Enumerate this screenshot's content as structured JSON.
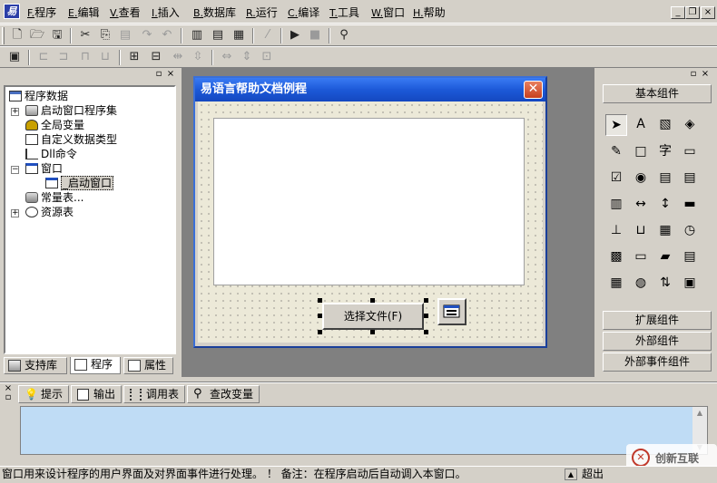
{
  "menu": {
    "items": [
      {
        "key": "F.",
        "label": "程序"
      },
      {
        "key": "E.",
        "label": "编辑"
      },
      {
        "key": "V.",
        "label": "查看"
      },
      {
        "key": "I.",
        "label": "插入"
      },
      {
        "key": "B.",
        "label": "数据库"
      },
      {
        "key": "R.",
        "label": "运行"
      },
      {
        "key": "C.",
        "label": "编译"
      },
      {
        "key": "T.",
        "label": "工具"
      },
      {
        "key": "W.",
        "label": "窗口"
      },
      {
        "key": "H.",
        "label": "帮助"
      }
    ]
  },
  "toolbar1": {
    "icons": [
      "new-file-icon",
      "open-folder-icon",
      "save-icon",
      "cut-icon",
      "copy-icon",
      "paste-icon",
      "redo-icon",
      "undo-icon",
      "layout-left-icon",
      "layout-top-icon",
      "layout-split-icon",
      "edit-disabled-icon",
      "run-icon",
      "stop-icon",
      "debug-icon"
    ]
  },
  "left_panel": {
    "tree": [
      {
        "label": "程序数据",
        "icon": "program-data-icon"
      },
      {
        "label": "启动窗口程序集",
        "icon": "assembly-icon"
      },
      {
        "label": "全局变量",
        "icon": "global-var-icon"
      },
      {
        "label": "自定义数据类型",
        "icon": "custom-type-icon"
      },
      {
        "label": "Dll命令",
        "icon": "dll-icon"
      },
      {
        "label": "窗口",
        "icon": "window-icon"
      },
      {
        "label": "_启动窗口",
        "icon": "window-icon"
      },
      {
        "label": "常量表...",
        "icon": "constants-icon"
      },
      {
        "label": "资源表",
        "icon": "resources-icon"
      }
    ],
    "tabs": [
      {
        "label": "支持库",
        "icon": "library-icon"
      },
      {
        "label": "程序",
        "icon": "program-icon"
      },
      {
        "label": "属性",
        "icon": "properties-icon"
      }
    ]
  },
  "form": {
    "title": "易语言帮助文档例程",
    "button_label": "选择文件(F)"
  },
  "right_panel": {
    "basic": "基本组件",
    "extended": "扩展组件",
    "external": "外部组件",
    "external_event": "外部事件组件"
  },
  "bottom": {
    "tabs": [
      {
        "label": "提示",
        "icon": "hint-icon"
      },
      {
        "label": "输出",
        "icon": "output-icon"
      },
      {
        "label": "调用表",
        "icon": "call-table-icon"
      },
      {
        "label": "查改变量",
        "icon": "inspect-var-icon"
      }
    ]
  },
  "status": {
    "text": "窗口用来设计程序的用户界面及对界面事件进行处理。 ！ 备注：在程序启动后自动调入本窗口。",
    "overflow": "超出"
  },
  "watermark": "创新互联"
}
